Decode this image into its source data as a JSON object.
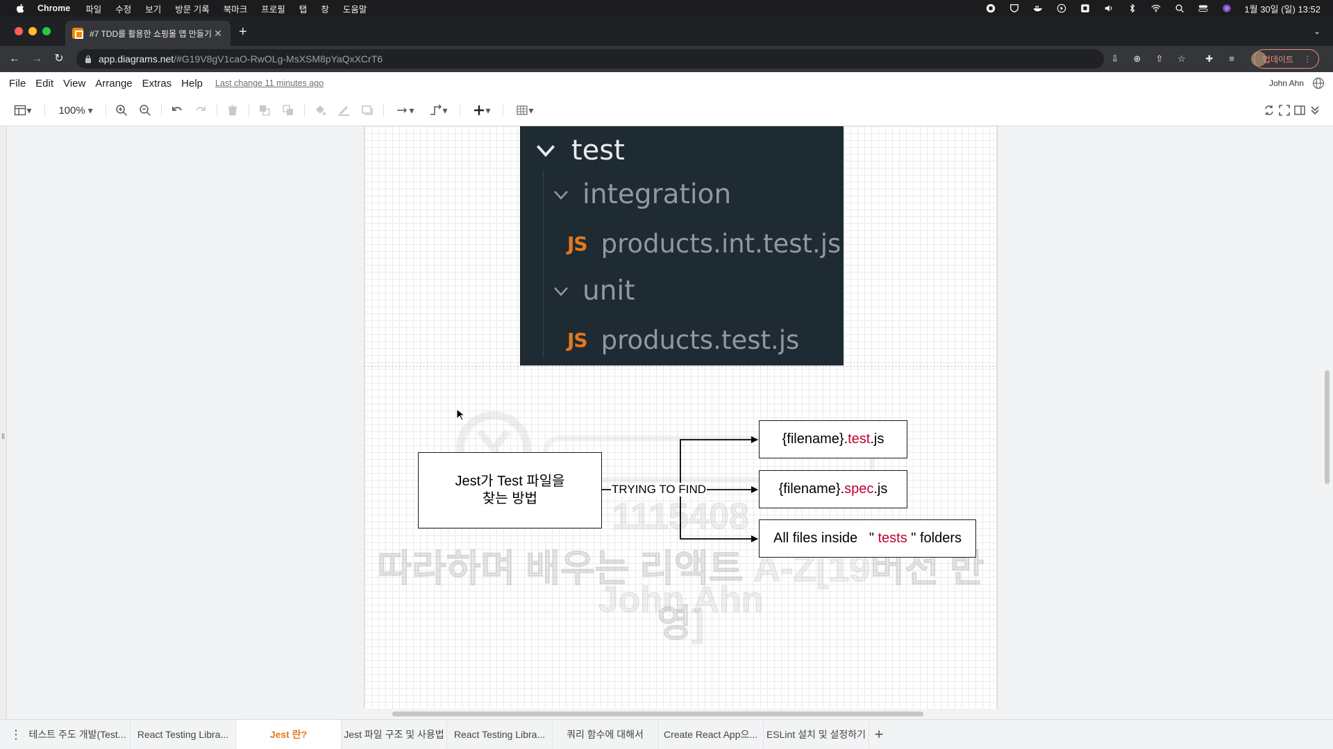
{
  "macos": {
    "app_name": "Chrome",
    "menus": [
      "파일",
      "수정",
      "보기",
      "방문 기록",
      "북마크",
      "프로필",
      "탭",
      "창",
      "도움말"
    ],
    "clock": "1월 30일 (일) 13:52"
  },
  "browser": {
    "tab_title": "#7 TDD를 활용한 쇼핑몰 앱 만들기",
    "url_host": "app.diagrams.net",
    "url_path": "/#G19V8gV1caO-RwOLg-MsXSM8pYaQxXCrT6",
    "update_label": "업데이트"
  },
  "drawio": {
    "menus": [
      "File",
      "Edit",
      "View",
      "Arrange",
      "Extras",
      "Help"
    ],
    "last_change": "Last change 11 minutes ago",
    "user_name": "John Ahn",
    "zoom": "100%"
  },
  "tree_image": {
    "root": "test",
    "folder1": "integration",
    "file1": "products.int.test.js",
    "folder2": "unit",
    "file2": "products.test.js",
    "js_badge": "JS"
  },
  "watermark": {
    "id": "1115408",
    "course": "따라하며 배우는 리액트 A-Z[19버전 반영]",
    "author": "John Ahn"
  },
  "diagram": {
    "source_line1": "Jest가 Test 파일을",
    "source_line2": "찾는 방법",
    "edge_label": "TRYING TO FIND",
    "target1_prefix": "{filename}.",
    "target1_highlight": "test",
    "target1_suffix": ".js",
    "target2_prefix": "{filename}.",
    "target2_highlight": "spec",
    "target2_suffix": ".js",
    "target3_prefix": "All files inside   \" ",
    "target3_highlight": "tests",
    "target3_suffix": " \" folders",
    "highlight_color": "#c0002f"
  },
  "page_tabs": [
    {
      "label": "테스트 주도 개발(Test...",
      "active": false
    },
    {
      "label": "React Testing Libra...",
      "active": false
    },
    {
      "label": "Jest 란?",
      "active": true
    },
    {
      "label": "Jest 파일 구조 및 사용법",
      "active": false
    },
    {
      "label": "React Testing Libra...",
      "active": false
    },
    {
      "label": "쿼리 함수에 대해서",
      "active": false
    },
    {
      "label": "Create React App으...",
      "active": false
    },
    {
      "label": "ESLint 설치 및 설정하기",
      "active": false
    }
  ]
}
